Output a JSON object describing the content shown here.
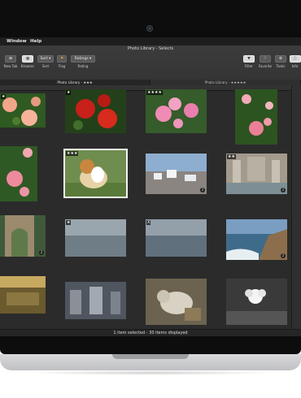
{
  "menubar": {
    "window": "Window",
    "help": "Help"
  },
  "window_title": "Photo Library - Selects",
  "toolbar": {
    "new_tab": "New Tab",
    "browser": "Browser",
    "sort": "Sort",
    "sort_button": "Sort ▾",
    "flag": "Flag",
    "rating": "Rating",
    "ratings_button": "Ratings ▾",
    "filter": "Filter",
    "favorite": "Favorite",
    "tasks": "Tasks",
    "info": "Info"
  },
  "tabs": [
    {
      "label": "Photo Library - ★★★"
    },
    {
      "label": "Photo Library - ★★★★★"
    }
  ],
  "photos": [
    {
      "rating": "★",
      "badge": ""
    },
    {
      "rating": "★",
      "badge": ""
    },
    {
      "rating": "★★★★",
      "badge": ""
    },
    {
      "rating": "",
      "badge": ""
    },
    {
      "rating": "",
      "badge": ""
    },
    {
      "rating": "★★★",
      "badge": ""
    },
    {
      "rating": "",
      "badge": "2"
    },
    {
      "rating": "★★",
      "badge": "2"
    },
    {
      "rating": "",
      "badge": "2"
    },
    {
      "rating": "★",
      "badge": ""
    },
    {
      "rating": "X",
      "badge": ""
    },
    {
      "rating": "",
      "badge": "2"
    },
    {
      "rating": "",
      "badge": ""
    },
    {
      "rating": "",
      "badge": ""
    },
    {
      "rating": "",
      "badge": ""
    },
    {
      "rating": "",
      "badge": ""
    }
  ],
  "status": "1 item selected - 30 items displayed",
  "colors": {
    "accent": "#f4f4f4",
    "background": "#2b2b2b",
    "toolbar": "#3a3a3a"
  }
}
